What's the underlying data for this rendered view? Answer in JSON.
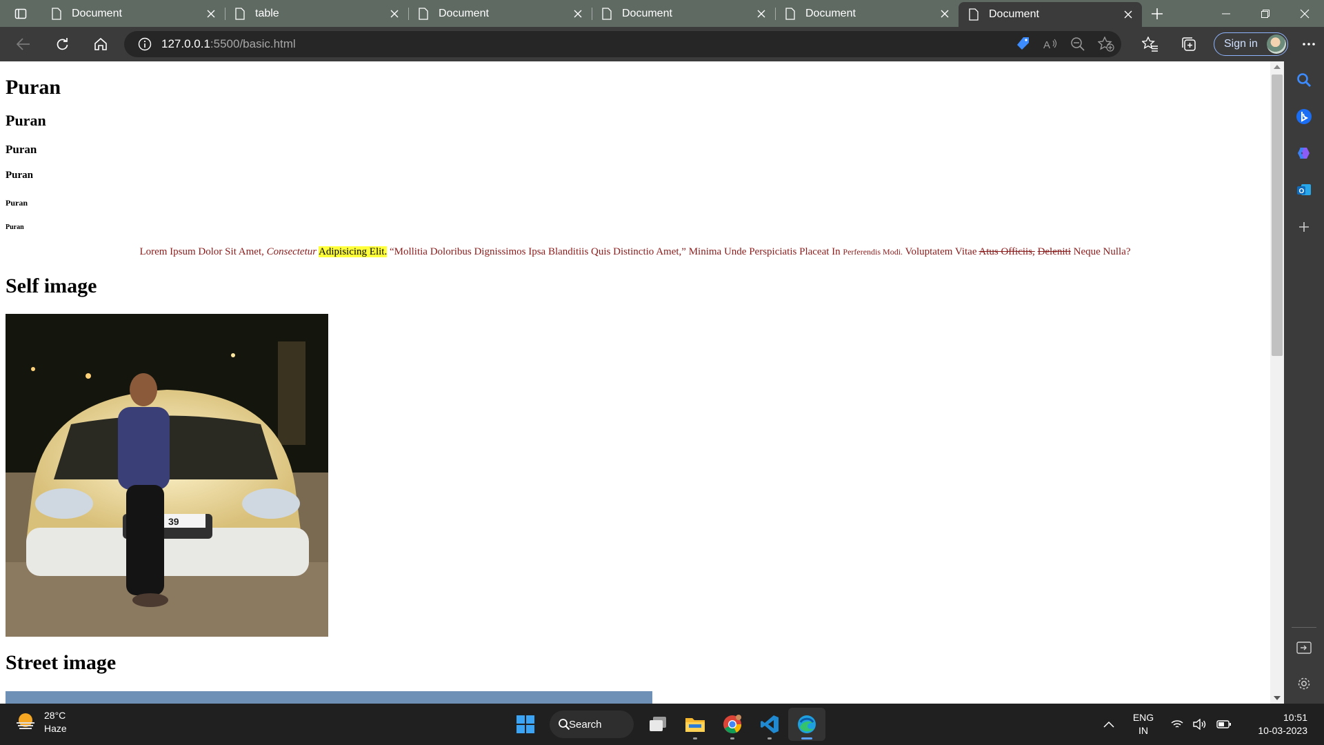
{
  "browser": {
    "tabs": [
      {
        "title": "Document",
        "active": false
      },
      {
        "title": "table",
        "active": false
      },
      {
        "title": "Document",
        "active": false
      },
      {
        "title": "Document",
        "active": false
      },
      {
        "title": "Document",
        "active": false
      },
      {
        "title": "Document",
        "active": true
      }
    ],
    "address": {
      "host": "127.0.0.1",
      "path": ":5500/basic.html"
    },
    "sign_in_label": "Sign in"
  },
  "page": {
    "headings": [
      "Puran",
      "Puran",
      "Puran",
      "Puran",
      "Puran",
      "Puran"
    ],
    "paragraph": {
      "part1": "Lorem Ipsum Dolor Sit Amet, ",
      "italic": "Consectetur",
      "highlight": "Adipisicing Elit.",
      "quote": " “Mollitia Doloribus Dignissimos Ipsa Blanditiis Quis Distinctio Amet,” Minima Unde Perspiciatis Placeat In ",
      "small": "Perferendis Modi.",
      "part2": " Voluptatem Vitae ",
      "strike1": "Atus Officiis,",
      "strike2": "Deleniti",
      "part3": " Neque Nulla?"
    },
    "self_image_heading": "Self image",
    "street_image_heading": "Street image",
    "photo_plate_text": "39"
  },
  "taskbar": {
    "weather": {
      "temp": "28°C",
      "condition": "Haze"
    },
    "search_label": "Search",
    "language": {
      "line1": "ENG",
      "line2": "IN"
    },
    "clock": {
      "time": "10:51",
      "date": "10-03-2023"
    }
  },
  "colors": {
    "tabstrip": "#5f6a63",
    "toolbar": "#3b3b3b",
    "paragraph_text": "#8b1a1a",
    "highlight": "#ffff3a"
  }
}
